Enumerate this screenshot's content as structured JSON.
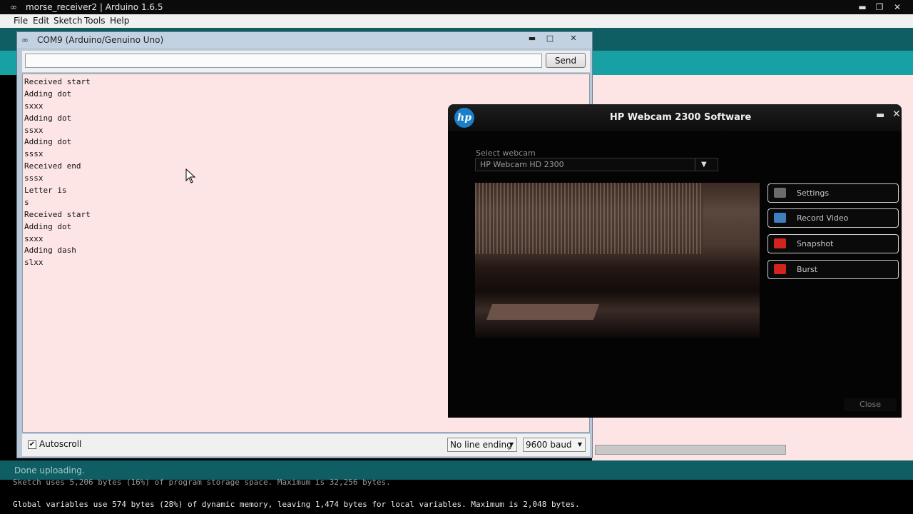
{
  "ide": {
    "title": "morse_receiver2 | Arduino 1.6.5",
    "menu": [
      "File",
      "Edit",
      "Sketch",
      "Tools",
      "Help"
    ],
    "status": "Done uploading.",
    "console": [
      "Sketch uses 5,206 bytes (16%) of program storage space. Maximum is 32,256 bytes.",
      "Global variables use 574 bytes (28%) of dynamic memory, leaving 1,474 bytes for local variables. Maximum is 2,048 bytes."
    ]
  },
  "serial_monitor": {
    "title": "COM9 (Arduino/Genuino Uno)",
    "input_value": "",
    "send_label": "Send",
    "output_lines": [
      "Received start",
      "Adding dot",
      "sxxx",
      "Adding dot",
      "ssxx",
      "Adding dot",
      "sssx",
      "Received end",
      "sssx",
      "Letter is",
      "s",
      "Received start",
      "Adding dot",
      "sxxx",
      "Adding dash",
      "slxx"
    ],
    "autoscroll_label": "Autoscroll",
    "autoscroll_checked": true,
    "line_ending": "No line ending",
    "baud": "9600 baud"
  },
  "webcam_app": {
    "logo": "hp",
    "title": "HP Webcam 2300 Software",
    "select_label": "Select webcam",
    "selected_webcam": "HP Webcam HD 2300",
    "buttons": [
      {
        "label": "Settings",
        "icon": "gear-icon",
        "color": "#6b6b6b"
      },
      {
        "label": "Record Video",
        "icon": "video-camera-icon",
        "color": "#3f7fbf"
      },
      {
        "label": "Snapshot",
        "icon": "snapshot-icon",
        "color": "#d0241c"
      },
      {
        "label": "Burst",
        "icon": "burst-icon",
        "color": "#d0241c"
      }
    ],
    "close_label": "Close"
  },
  "colors": {
    "ide_teal": "#0e5e63",
    "ide_teal_light": "#17a1a5",
    "serial_bg": "#fde5e5",
    "hp_blue": "#1a7fc6"
  }
}
